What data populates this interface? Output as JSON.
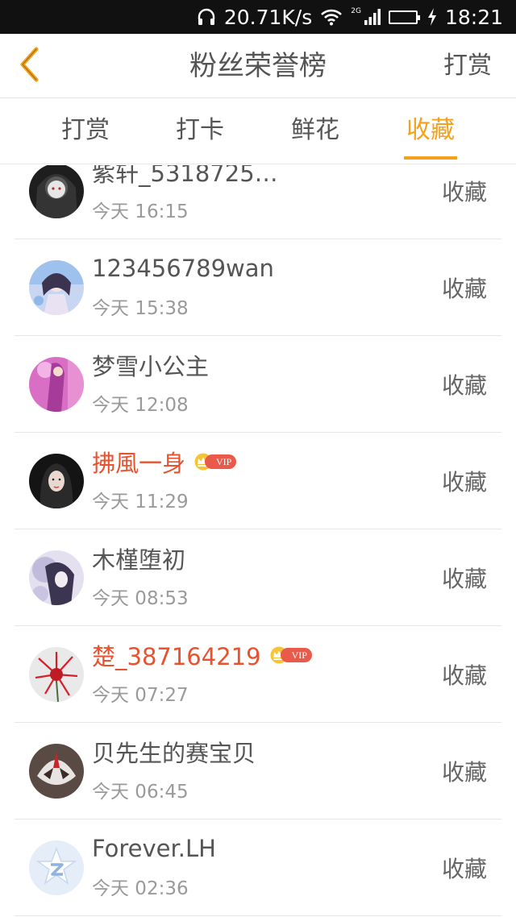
{
  "status_bar": {
    "speed": "20.71K/s",
    "network": "2G",
    "time": "18:21",
    "battery_color": "#25c13b",
    "icons": [
      "headphones-icon",
      "wifi-icon",
      "signal-icon",
      "battery-icon",
      "charging-icon"
    ]
  },
  "header": {
    "back_icon": "chevron-left-icon",
    "title": "粉丝荣誉榜",
    "action": "打赏"
  },
  "tabs": [
    {
      "label": "打赏",
      "active": false
    },
    {
      "label": "打卡",
      "active": false
    },
    {
      "label": "鲜花",
      "active": false
    },
    {
      "label": "收藏",
      "active": true
    }
  ],
  "accent_color": "#f5a11a",
  "vip_name_color": "#e8522f",
  "vip_badge_label": "VIP",
  "list": [
    {
      "name": "紫轩_5318725…",
      "time": "今天 16:15",
      "action": "收藏",
      "vip": false
    },
    {
      "name": "123456789wan",
      "time": "今天 15:38",
      "action": "收藏",
      "vip": false
    },
    {
      "name": "梦雪小公主",
      "time": "今天 12:08",
      "action": "收藏",
      "vip": false
    },
    {
      "name": "拂風一身",
      "time": "今天 11:29",
      "action": "收藏",
      "vip": true
    },
    {
      "name": "木槿堕初",
      "time": "今天 08:53",
      "action": "收藏",
      "vip": false
    },
    {
      "name": "楚_387164219",
      "time": "今天 07:27",
      "action": "收藏",
      "vip": true
    },
    {
      "name": "贝先生的赛宝贝",
      "time": "今天 06:45",
      "action": "收藏",
      "vip": false
    },
    {
      "name": "Forever.LH",
      "time": "今天 02:36",
      "action": "收藏",
      "vip": false
    }
  ]
}
